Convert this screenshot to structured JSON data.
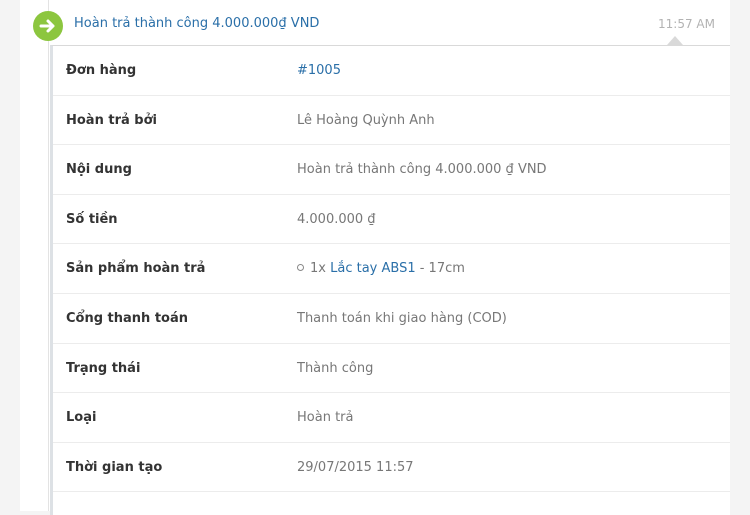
{
  "header": {
    "title": "Hoàn trả thành công 4.000.000₫ VND",
    "time": "11:57 AM",
    "icon": "arrow-right-circle-icon",
    "accent": "#8cc63f"
  },
  "details": {
    "order": {
      "label": "Đơn hàng",
      "value": "#1005"
    },
    "refunded_by": {
      "label": "Hoàn trả bởi",
      "value": "Lê Hoàng Quỳnh Anh"
    },
    "content": {
      "label": "Nội dung",
      "value": "Hoàn trả thành công 4.000.000 ₫  VND"
    },
    "amount": {
      "label": "Số tiền",
      "value": "4.000.000 ₫"
    },
    "products": {
      "label": "Sản phẩm hoàn trả",
      "qty": "1x",
      "name": "Lắc tay ABS1",
      "variant": " - 17cm"
    },
    "gateway": {
      "label": "Cổng thanh toán",
      "value": "Thanh toán khi giao hàng (COD)"
    },
    "status": {
      "label": "Trạng thái",
      "value": "Thành công"
    },
    "type": {
      "label": "Loại",
      "value": "Hoàn trả"
    },
    "created_at": {
      "label": "Thời gian tạo",
      "value": "29/07/2015 11:57"
    }
  },
  "colors": {
    "link": "#2a6fa8",
    "text_muted": "#777777",
    "label": "#333333"
  }
}
